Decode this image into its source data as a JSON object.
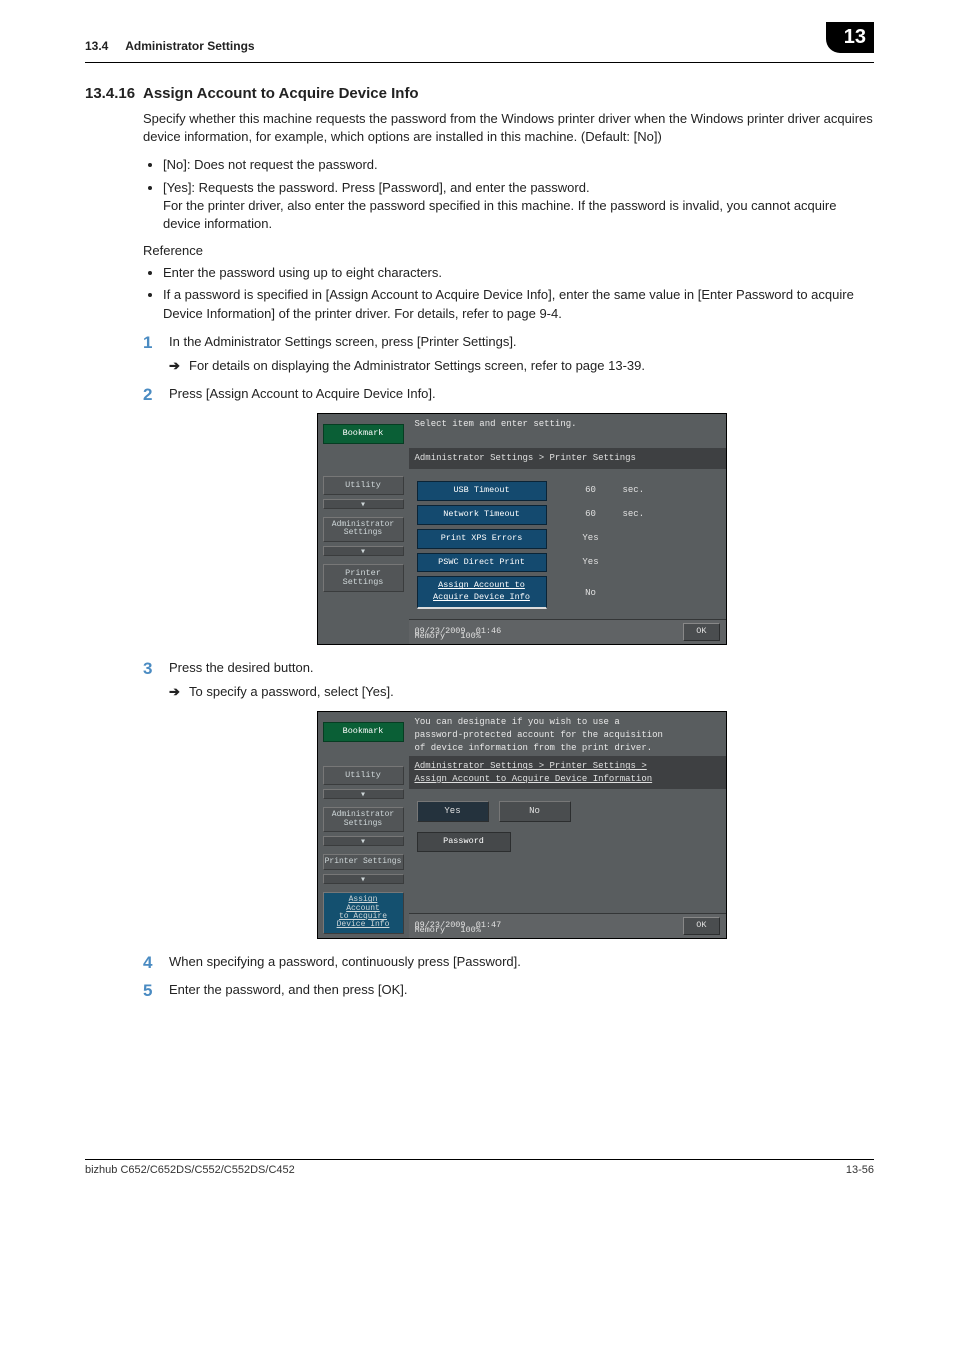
{
  "header": {
    "section_number": "13.4",
    "section_title": "Administrator Settings",
    "chapter_badge": "13"
  },
  "subsection": {
    "number": "13.4.16",
    "title": "Assign Account to Acquire Device Info"
  },
  "intro": "Specify whether this machine requests the password from the Windows printer driver when the Windows printer driver acquires device information, for example, which options are installed in this machine. (Default: [No])",
  "intro_bullets": [
    "[No]: Does not request the password.",
    "[Yes]: Requests the password. Press [Password], and enter the password.\nFor the printer driver, also enter the password specified in this machine. If the password is invalid, you cannot acquire device information."
  ],
  "reference_heading": "Reference",
  "reference_bullets": [
    "Enter the password using up to eight characters.",
    "If a password is specified in [Assign Account to Acquire Device Info], enter the same value in [Enter Password to acquire Device Information] of the printer driver. For details, refer to page 9-4."
  ],
  "steps": {
    "s1": "In the Administrator Settings screen, press [Printer Settings].",
    "s1_sub": "For details on displaying the Administrator Settings screen, refer to page 13-39.",
    "s2": "Press [Assign Account to Acquire Device Info].",
    "s3": "Press the desired button.",
    "s3_sub": "To specify a password, select [Yes].",
    "s4": "When specifying a password, continuously press [Password].",
    "s5": "Enter the password, and then press [OK]."
  },
  "panel1": {
    "instruction": "Select item and enter setting.",
    "breadcrumb": "Administrator Settings > Printer Settings",
    "side": {
      "bookmark": "Bookmark",
      "utility": "Utility",
      "admin": "Administrator\nSettings",
      "printer": "Printer Settings"
    },
    "rows": {
      "usb_label": "USB Timeout",
      "usb_val": "60",
      "usb_unit": "sec.",
      "net_label": "Network Timeout",
      "net_val": "60",
      "net_unit": "sec.",
      "xps_label": "Print XPS Errors",
      "xps_val": "Yes",
      "psw_label": "PSWC Direct Print",
      "psw_val": "Yes",
      "acc_label": "Assign Account to\nAcquire Device Info",
      "acc_val": "No"
    },
    "footer": {
      "date": "09/23/2009",
      "time": "01:46",
      "mem_label": "Memory",
      "mem_val": "100%",
      "ok": "OK"
    }
  },
  "panel2": {
    "instruction": "You can designate if you wish to use a\npassword-protected account for the acquisition\nof device information from the print driver.",
    "breadcrumb": "Administrator Settings > Printer Settings >\nAssign Account to Acquire Device Information",
    "side": {
      "bookmark": "Bookmark",
      "utility": "Utility",
      "admin": "Administrator\nSettings",
      "printer": "Printer Settings",
      "assign": "Assign\nAccount\nto Acquire\nDevice Info"
    },
    "buttons": {
      "yes": "Yes",
      "no": "No",
      "password": "Password"
    },
    "footer": {
      "date": "09/23/2009",
      "time": "01:47",
      "mem_label": "Memory",
      "mem_val": "100%",
      "ok": "OK"
    }
  },
  "footer": {
    "left": "bizhub C652/C652DS/C552/C552DS/C452",
    "right": "13-56"
  }
}
